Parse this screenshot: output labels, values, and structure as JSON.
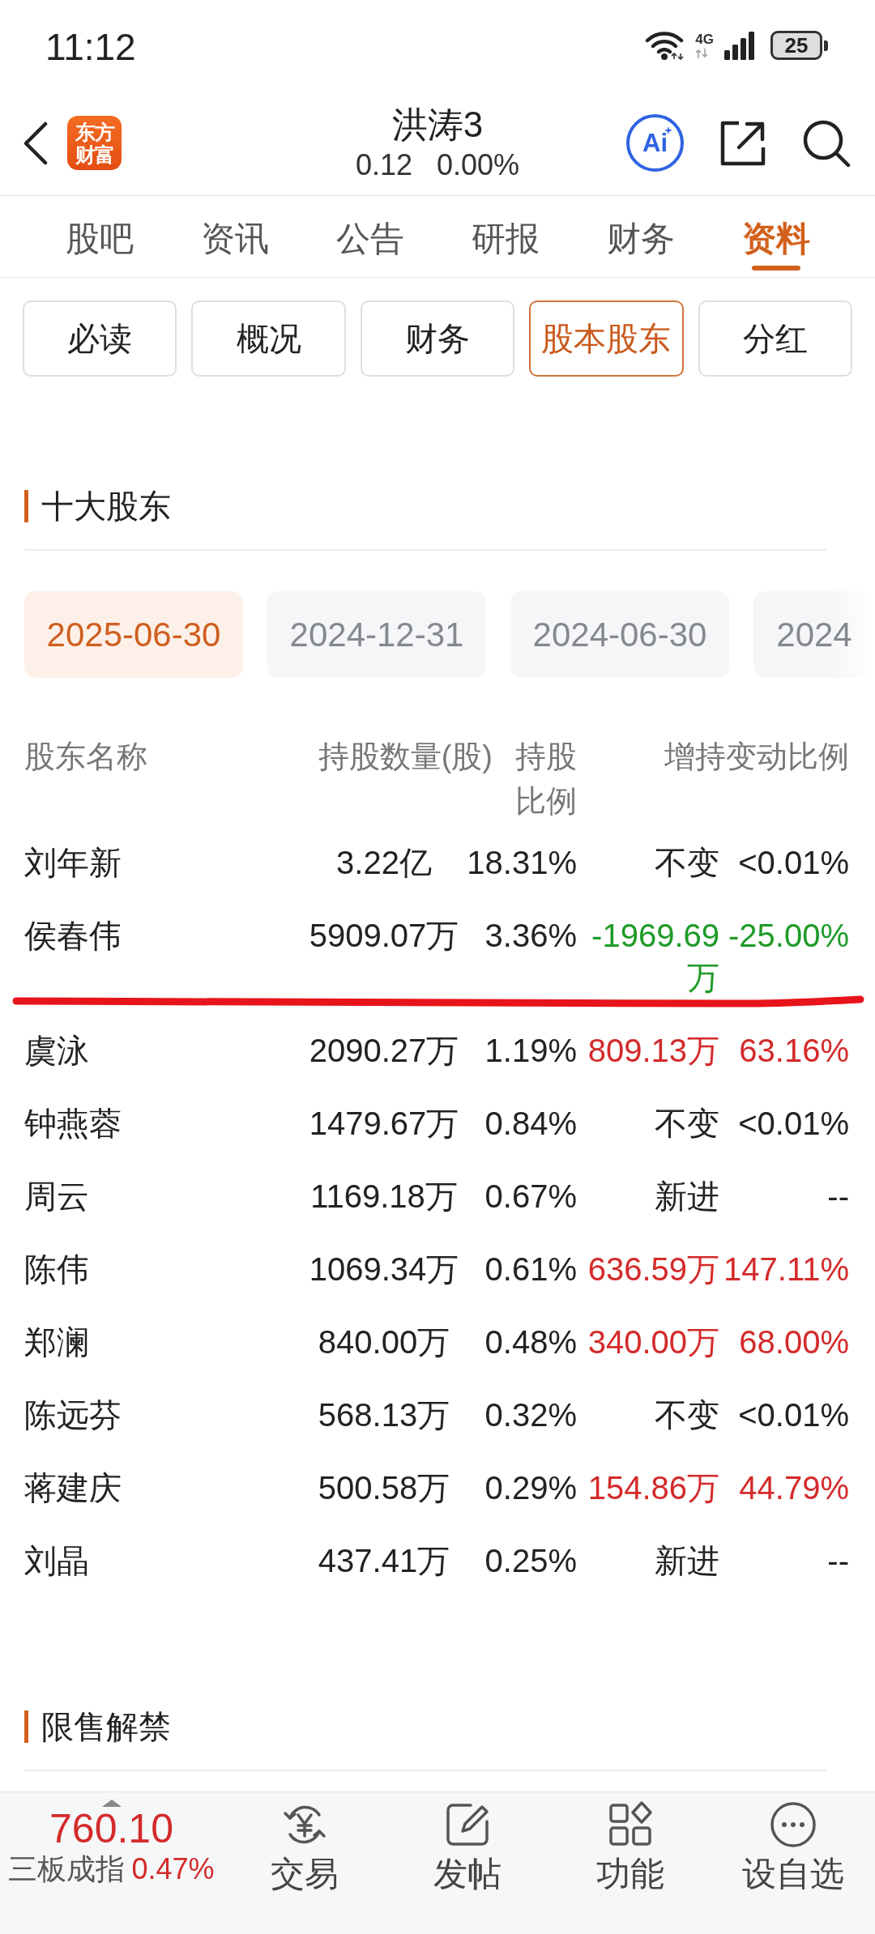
{
  "status_bar": {
    "time": "11:12",
    "network": "4G",
    "battery": "25"
  },
  "header": {
    "logo": [
      "东方",
      "财富"
    ],
    "title": "洪涛3",
    "price": "0.12",
    "change": "0.00%",
    "ai_label": "Ai"
  },
  "tabs": [
    {
      "label": "股吧",
      "selected": false
    },
    {
      "label": "资讯",
      "selected": false
    },
    {
      "label": "公告",
      "selected": false
    },
    {
      "label": "研报",
      "selected": false
    },
    {
      "label": "财务",
      "selected": false
    },
    {
      "label": "资料",
      "selected": true
    }
  ],
  "sub_tabs": [
    {
      "label": "必读",
      "selected": false
    },
    {
      "label": "概况",
      "selected": false
    },
    {
      "label": "财务",
      "selected": false
    },
    {
      "label": "股本股东",
      "selected": true
    },
    {
      "label": "分红",
      "selected": false
    }
  ],
  "sections": [
    {
      "title": "十大股东",
      "dates": [
        {
          "label": "2025-06-30",
          "selected": true
        },
        {
          "label": "2024-12-31",
          "selected": false
        },
        {
          "label": "2024-06-30",
          "selected": false
        },
        {
          "label": "2024",
          "selected": false
        }
      ],
      "table": {
        "columns": [
          "股东名称",
          "持股数量(股)",
          "持股比例",
          "增持变动比例"
        ],
        "rows": [
          {
            "name": "刘年新",
            "shares": "3.22亿",
            "ratio": "18.31%",
            "change_amount": "不变",
            "change_ratio": "<0.01%",
            "color": "#222222"
          },
          {
            "name": "侯春伟",
            "shares": "5909.07万",
            "ratio": "3.36%",
            "change_amount": "-1969.69万",
            "change_ratio": "-25.00%",
            "color": "#1e9a28"
          },
          {
            "name": "虞泳",
            "shares": "2090.27万",
            "ratio": "1.19%",
            "change_amount": "809.13万",
            "change_ratio": "63.16%",
            "color": "#d42a2a"
          },
          {
            "name": "钟燕蓉",
            "shares": "1479.67万",
            "ratio": "0.84%",
            "change_amount": "不变",
            "change_ratio": "<0.01%",
            "color": "#222222"
          },
          {
            "name": "周云",
            "shares": "1169.18万",
            "ratio": "0.67%",
            "change_amount": "新进",
            "change_ratio": "--",
            "color": "#222222"
          },
          {
            "name": "陈伟",
            "shares": "1069.34万",
            "ratio": "0.61%",
            "change_amount": "636.59万",
            "change_ratio": "147.11%",
            "color": "#d42a2a"
          },
          {
            "name": "郑澜",
            "shares": "840.00万",
            "ratio": "0.48%",
            "change_amount": "340.00万",
            "change_ratio": "68.00%",
            "color": "#d42a2a"
          },
          {
            "name": "陈远芬",
            "shares": "568.13万",
            "ratio": "0.32%",
            "change_amount": "不变",
            "change_ratio": "<0.01%",
            "color": "#222222"
          },
          {
            "name": "蒋建庆",
            "shares": "500.58万",
            "ratio": "0.29%",
            "change_amount": "154.86万",
            "change_ratio": "44.79%",
            "color": "#d42a2a"
          },
          {
            "name": "刘晶",
            "shares": "437.41万",
            "ratio": "0.25%",
            "change_amount": "新进",
            "change_ratio": "--",
            "color": "#222222"
          }
        ]
      }
    },
    {
      "title": "限售解禁"
    }
  ],
  "bottom_bar": {
    "index": {
      "value": "760.10",
      "name": "三板成指",
      "change": "0.47%",
      "color": "#d42a2a"
    },
    "items": [
      {
        "label": "交易",
        "kind": "trade"
      },
      {
        "label": "发帖",
        "kind": "post"
      },
      {
        "label": "功能",
        "kind": "functions"
      },
      {
        "label": "设自选",
        "kind": "watchlist"
      }
    ]
  }
}
